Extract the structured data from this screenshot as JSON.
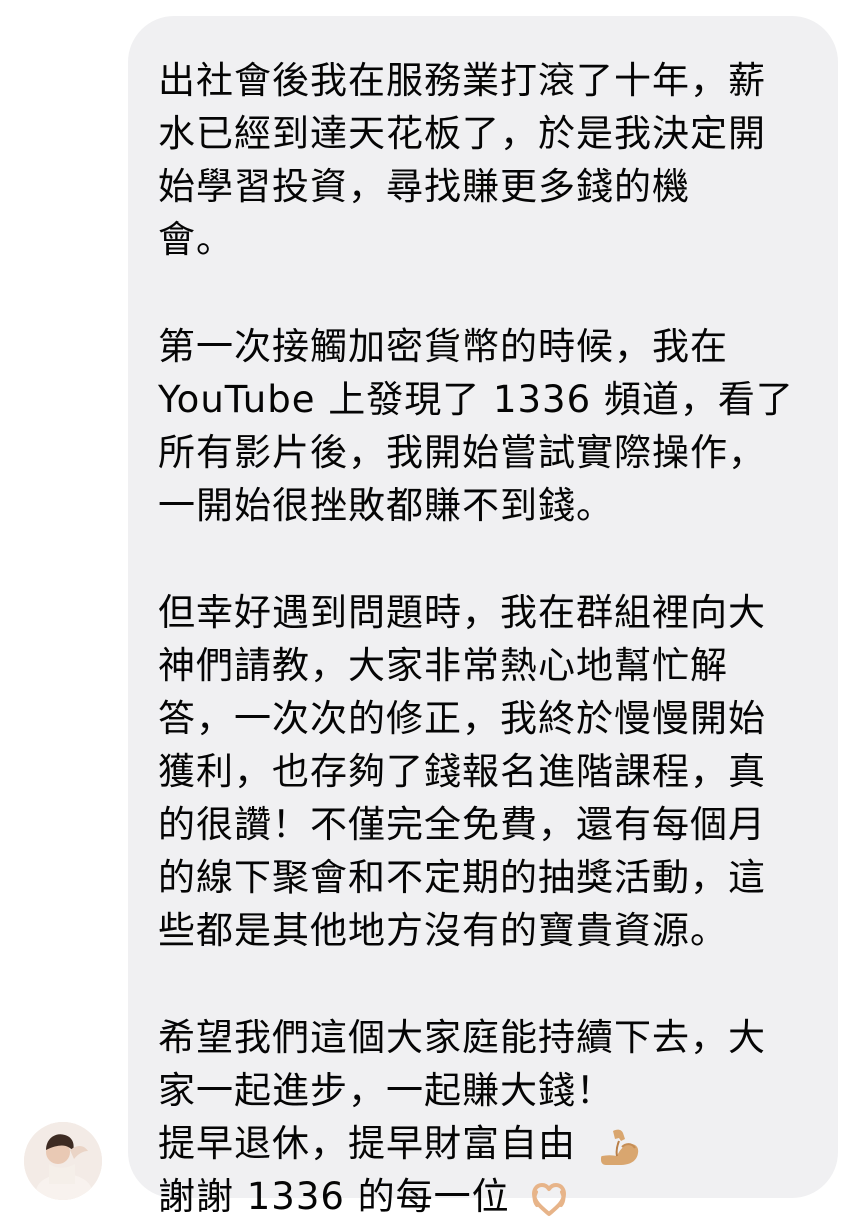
{
  "message": {
    "paragraphs": [
      [
        "出社會後我在服務業打滾了十年，薪",
        "水已經到達天花板了，於是我決定開",
        "始學習投資，尋找賺更多錢的機",
        "會。"
      ],
      [
        "第一次接觸加密貨幣的時候，我在",
        " YouTube 上發現了 1336 頻道，看了",
        "所有影片後，我開始嘗試實際操作，",
        "一開始很挫敗都賺不到錢。"
      ],
      [
        "但幸好遇到問題時，我在群組裡向大",
        "神們請教，大家非常熱心地幫忙解",
        "答，一次次的修正，我終於慢慢開始",
        "獲利，也存夠了錢報名進階課程，真",
        "的很讚！不僅完全免費，還有每個月",
        "的線下聚會和不定期的抽獎活動，這",
        "些都是其他地方沒有的寶貴資源。"
      ],
      [
        "希望我們這個大家庭能持續下去，大",
        "家一起進步，一起賺大錢！",
        "提早退休，提早財富自由",
        "謝謝 1336 的每一位"
      ]
    ],
    "emojis": {
      "flexed_biceps": "flexed-biceps-icon",
      "heart_hands": "heart-hands-icon"
    }
  },
  "colors": {
    "bubble_background": "#f0f0f2",
    "text": "#050505"
  }
}
